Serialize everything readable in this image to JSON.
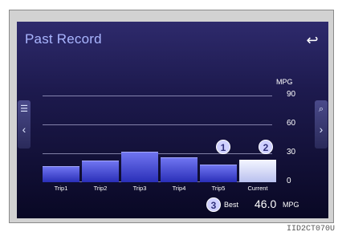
{
  "screen": {
    "title": "Past Record",
    "back_icon": "back-arrow-icon",
    "left_tab_icon": "list-icon",
    "right_tab_icon": "search-icon"
  },
  "chart_data": {
    "type": "bar",
    "unit": "MPG",
    "categories": [
      "Trip1",
      "Trip2",
      "Trip3",
      "Trip4",
      "Trip5",
      "Current"
    ],
    "values": [
      16,
      22,
      31,
      25,
      18,
      23
    ],
    "ylim": [
      0,
      90
    ],
    "yticks": [
      "90",
      "60",
      "30",
      "0"
    ],
    "highlight": "Current"
  },
  "markers": [
    "1",
    "2",
    "3"
  ],
  "best": {
    "label": "Best",
    "value": "46.0",
    "unit": "MPG"
  },
  "image_id": "IID2CT070U"
}
